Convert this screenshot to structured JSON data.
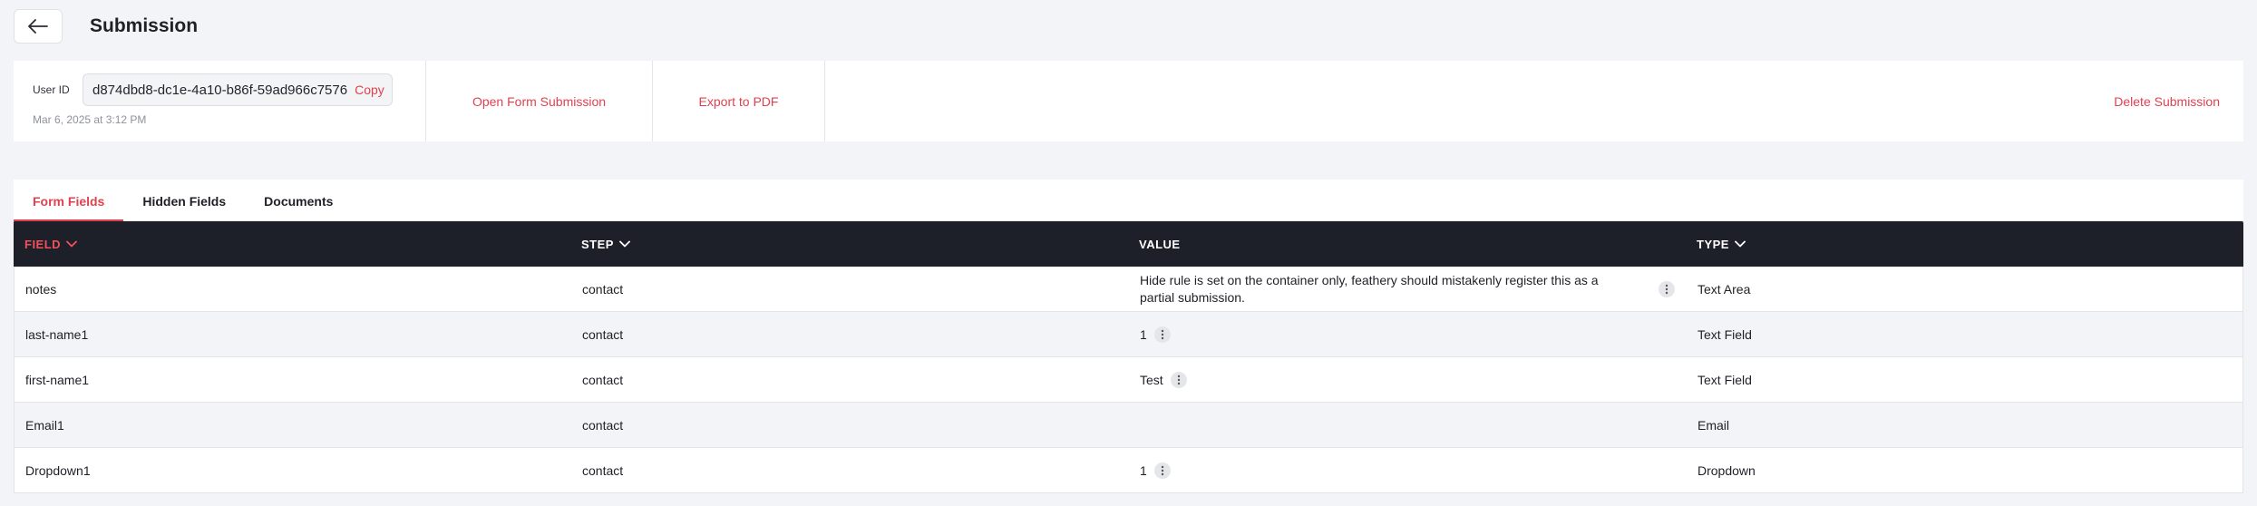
{
  "header": {
    "back_icon": "arrow-left-icon",
    "title": "Submission"
  },
  "info": {
    "user_label": "User ID",
    "user_id": "d874dbd8-dc1e-4a10-b86f-59ad966c7576",
    "copy_label": "Copy",
    "date": "Mar 6, 2025 at 3:12 PM",
    "open_label": "Open Form Submission",
    "export_label": "Export to PDF",
    "delete_label": "Delete Submission"
  },
  "tabs": [
    {
      "label": "Form Fields",
      "active": true
    },
    {
      "label": "Hidden Fields",
      "active": false
    },
    {
      "label": "Documents",
      "active": false
    }
  ],
  "table": {
    "headers": {
      "field": "FIELD",
      "step": "STEP",
      "value": "VALUE",
      "type": "TYPE"
    },
    "rows": [
      {
        "field": "notes",
        "step": "contact",
        "value": "Hide rule is set on the container only, feathery should mistakenly register this as a partial submission.",
        "type": "Text Area"
      },
      {
        "field": "last-name1",
        "step": "contact",
        "value": "1",
        "type": "Text Field"
      },
      {
        "field": "first-name1",
        "step": "contact",
        "value": "Test",
        "type": "Text Field"
      },
      {
        "field": "Email1",
        "step": "contact",
        "value": "",
        "type": "Email"
      },
      {
        "field": "Dropdown1",
        "step": "contact",
        "value": "1",
        "type": "Dropdown"
      }
    ]
  },
  "colors": {
    "accent": "#e0414f",
    "header_bg": "#1e2029",
    "page_bg": "#f3f4f7"
  }
}
